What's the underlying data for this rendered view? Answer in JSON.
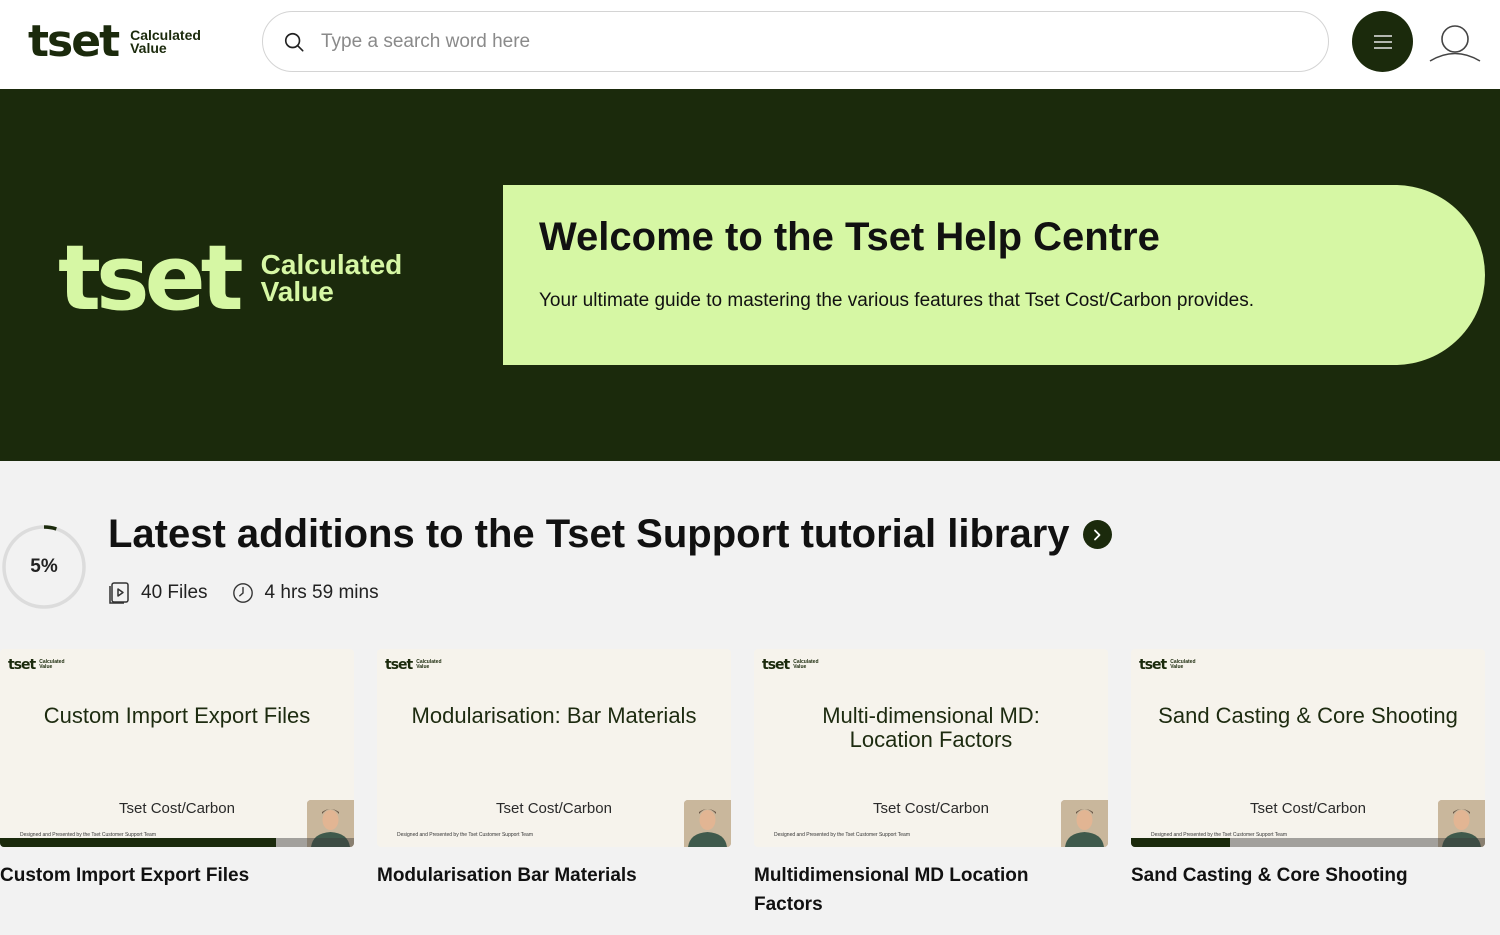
{
  "header": {
    "logo_mark": "tset",
    "logo_tag_1": "Calculated",
    "logo_tag_2": "Value",
    "search_placeholder": "Type a search word here"
  },
  "hero": {
    "logo_mark": "tset",
    "logo_tag_1": "Calculated",
    "logo_tag_2": "Value",
    "title": "Welcome to the Tset Help Centre",
    "subtitle": "Your ultimate guide to mastering the various features that Tset Cost/Carbon provides."
  },
  "section": {
    "progress_label": "5%",
    "progress_fraction": 0.05,
    "title": "Latest additions to the Tset Support tutorial library",
    "files": "40 Files",
    "duration": "4 hrs 59 mins"
  },
  "cards": [
    {
      "thumb_title": "Custom Import Export Files",
      "brand": "Tset Cost/Carbon",
      "credit": "Designed and Presented by the Tset Customer Support Team",
      "name": "Custom Import Export Files",
      "progress": 0.78
    },
    {
      "thumb_title": "Modularisation: Bar Materials",
      "brand": "Tset Cost/Carbon",
      "credit": "Designed and Presented by the Tset Customer Support Team",
      "name": "Modularisation Bar Materials",
      "progress": 0
    },
    {
      "thumb_title": "Multi-dimensional MD: Location Factors",
      "brand": "Tset Cost/Carbon",
      "credit": "Designed and Presented by the Tset Customer Support Team",
      "name": "Multidimensional MD Location Factors",
      "progress": 0
    },
    {
      "thumb_title": "Sand Casting & Core Shooting",
      "brand": "Tset Cost/Carbon",
      "credit": "Designed and Presented by the Tset Customer Support Team",
      "name": "Sand Casting & Core Shooting",
      "progress": 0.28
    }
  ],
  "colors": {
    "brand_dark": "#1b2a0c",
    "brand_lime": "#d6f7a4",
    "page_bg": "#f2f2f2"
  }
}
